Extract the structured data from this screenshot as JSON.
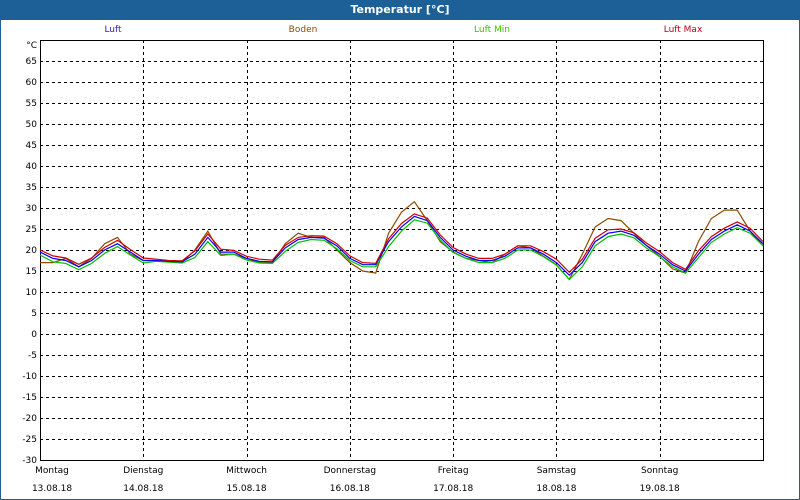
{
  "window": {
    "title": "Temperatur [°C]"
  },
  "chart_data": {
    "type": "line",
    "title": "Temperatur [°C]",
    "ylabel": "°C",
    "ylim": [
      -30,
      70
    ],
    "yticks": [
      65,
      60,
      55,
      50,
      45,
      40,
      35,
      30,
      25,
      20,
      15,
      10,
      5,
      0,
      -5,
      -10,
      -15,
      -20,
      -25,
      -30
    ],
    "xlim_days": [
      0,
      7
    ],
    "x_step_days": 0.125,
    "grid": true,
    "legend_placement": "top",
    "x_labels": [
      {
        "day": "Montag",
        "date": "13.08.18"
      },
      {
        "day": "Dienstag",
        "date": "14.08.18"
      },
      {
        "day": "Mittwoch",
        "date": "15.08.18"
      },
      {
        "day": "Donnerstag",
        "date": "16.08.18"
      },
      {
        "day": "Freitag",
        "date": "17.08.18"
      },
      {
        "day": "Samstag",
        "date": "18.08.18"
      },
      {
        "day": "Sonntag",
        "date": "19.08.18"
      }
    ],
    "series": [
      {
        "name": "Boden",
        "color": "#8b4a00",
        "values": [
          17,
          17,
          18,
          16,
          18,
          21.5,
          23,
          19,
          17.5,
          17.5,
          17.3,
          17,
          20,
          24.5,
          19,
          19,
          18,
          17,
          17,
          21.5,
          24,
          23,
          23,
          20,
          17,
          15,
          14.5,
          24,
          29,
          31.5,
          27,
          22,
          19.5,
          18,
          17.5,
          17,
          19,
          21,
          20.5,
          18.5,
          16.5,
          13,
          19,
          25.5,
          27.5,
          27,
          24,
          21,
          18.5,
          15.5,
          14.5,
          22,
          27.5,
          29.5,
          29.5,
          24.5,
          21
        ]
      },
      {
        "name": "Luft Min",
        "color": "#00c000",
        "values": [
          18.8,
          17.2,
          16.8,
          15.3,
          16.8,
          19.2,
          20.8,
          18.8,
          16.9,
          17.3,
          17.1,
          16.9,
          18.2,
          22,
          18.7,
          19,
          17.6,
          16.9,
          16.8,
          19.7,
          21.8,
          22.5,
          22.3,
          20.3,
          17.5,
          16,
          16,
          20.8,
          24.5,
          27.2,
          26.4,
          22.4,
          19.4,
          18,
          17,
          17,
          18,
          20,
          20,
          18.4,
          16.4,
          13,
          16,
          21,
          23.2,
          23.8,
          22.9,
          20.4,
          18.4,
          16,
          14.5,
          18.2,
          21.8,
          23.8,
          25.3,
          24,
          21
        ]
      },
      {
        "name": "Luft",
        "color": "#0000ff",
        "values": [
          19.5,
          18,
          17.5,
          16,
          17.5,
          20,
          21.5,
          19.5,
          17.5,
          17.5,
          17.3,
          17.2,
          19,
          23,
          19.5,
          19.5,
          18,
          17.3,
          17.2,
          20.5,
          22.5,
          23,
          22.8,
          21,
          18,
          16.5,
          16.5,
          22,
          25.5,
          28,
          27,
          23,
          20,
          18.5,
          17.5,
          17.5,
          18.5,
          20.5,
          20.5,
          19,
          17,
          14,
          17,
          22,
          24,
          24.5,
          23.5,
          21,
          19,
          16.5,
          15,
          19,
          22.5,
          24.5,
          26,
          24.5,
          21.5
        ]
      },
      {
        "name": "Luft Max",
        "color": "#d00000",
        "values": [
          20,
          18.6,
          18.1,
          16.6,
          18.1,
          20.6,
          22.3,
          20.1,
          18.1,
          17.8,
          17.5,
          17.4,
          19.8,
          23.8,
          20.2,
          19.9,
          18.5,
          17.8,
          17.6,
          21.1,
          23,
          23.4,
          23.3,
          21.5,
          18.6,
          17,
          16.8,
          22.7,
          26.3,
          28.6,
          27.6,
          23.6,
          20.6,
          19,
          18,
          18,
          19,
          21,
          21,
          19.6,
          17.8,
          14.7,
          17.8,
          22.8,
          24.8,
          25,
          24.1,
          21.6,
          19.6,
          17,
          15.4,
          19.8,
          23.2,
          25.2,
          26.7,
          25.2,
          22
        ]
      }
    ],
    "legend": [
      {
        "name": "Luft",
        "color": "#3020c0"
      },
      {
        "name": "Boden",
        "color": "#8b4a00"
      },
      {
        "name": "Luft Min",
        "color": "#40c000"
      },
      {
        "name": "Luft Max",
        "color": "#c00020"
      }
    ]
  }
}
